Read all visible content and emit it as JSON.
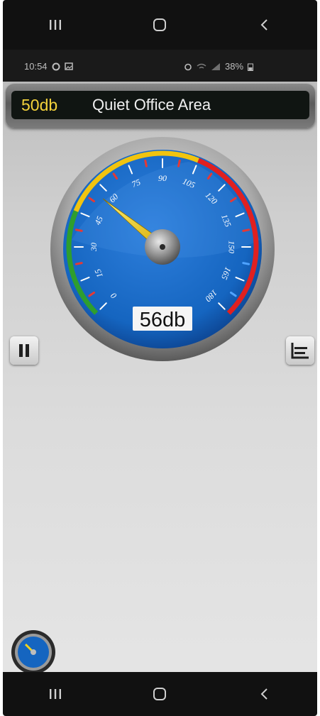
{
  "system_nav": {
    "recents_icon": "recents-icon",
    "home_icon": "home-icon",
    "back_icon": "back-icon"
  },
  "status_bar": {
    "time": "10:54",
    "battery": "38%"
  },
  "header": {
    "db_value": "50db",
    "area_label": "Quiet Office Area"
  },
  "gauge": {
    "reading_label": "56db",
    "reading": 56,
    "min": 0,
    "max": 180,
    "tick_labels": [
      "0",
      "15",
      "30",
      "45",
      "60",
      "75",
      "90",
      "105",
      "120",
      "135",
      "150",
      "165",
      "180"
    ],
    "colors": {
      "face": "#1565c0",
      "needle": "#f2d21b",
      "arc_low": "#2e9e2e",
      "arc_mid": "#f1c40f",
      "arc_high": "#e02020"
    }
  },
  "controls": {
    "pause_icon": "pause-icon",
    "chart_icon": "chart-icon",
    "mini_gauge_icon": "mini-gauge-icon"
  }
}
